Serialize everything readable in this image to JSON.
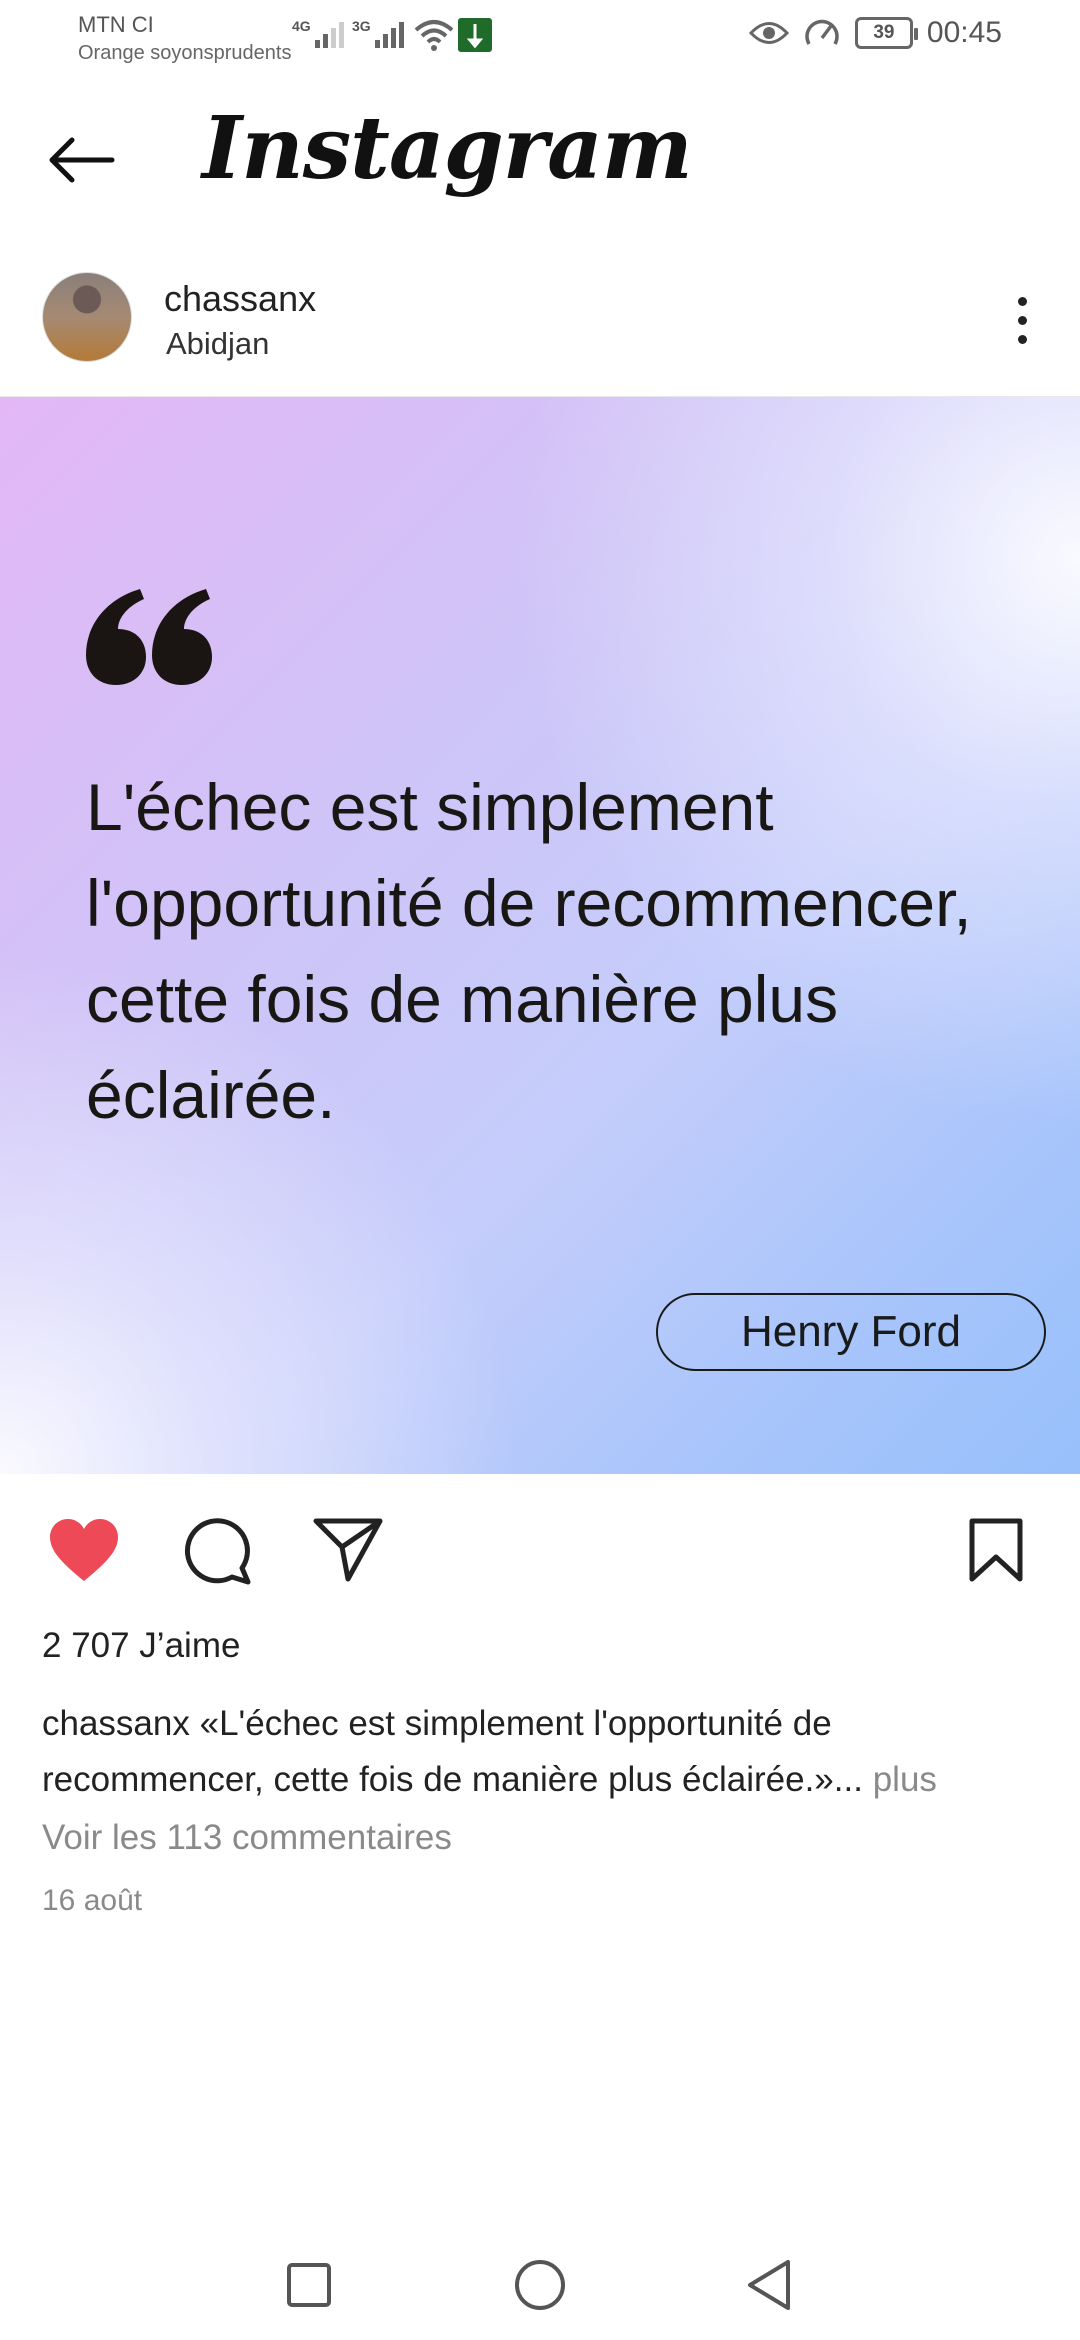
{
  "status_bar": {
    "carrier_primary": "MTN CI",
    "carrier_secondary": "Orange soyonsprudents",
    "network_1": "4G",
    "network_2": "3G",
    "battery_level": "39",
    "time": "00:45",
    "icons": [
      "signal-icon",
      "wifi-icon",
      "notification-icon",
      "eye-icon",
      "speed-icon",
      "battery-icon"
    ]
  },
  "app_bar": {
    "title": "Instagram",
    "back_icon": "arrow-left-icon"
  },
  "post": {
    "username": "chassanx",
    "location": "Abidjan",
    "image": {
      "quote": "L'échec est simplement l'opportunité de recommencer, cette fois de manière plus éclairée.",
      "author": "Henry Ford",
      "colors": {
        "gradient_start": "#e3b7f6",
        "gradient_end": "#98c0fb"
      }
    },
    "actions": {
      "like_icon": "heart-icon",
      "comment_icon": "comment-icon",
      "share_icon": "send-icon",
      "save_icon": "bookmark-icon",
      "liked": true,
      "like_color": "#ed4956"
    },
    "likes": "2 707 J’aime",
    "caption_user": "chassanx",
    "caption_text": "«L'échec est simplement l'opportunité de recommencer, cette fois de manière plus éclairée.»",
    "caption_ellipsis": "...",
    "caption_more": "plus",
    "view_comments": "Voir les 113 commentaires",
    "date": "16 août"
  },
  "nav_bar": {
    "items": [
      "recents-icon",
      "home-icon",
      "back-triangle-icon"
    ]
  }
}
